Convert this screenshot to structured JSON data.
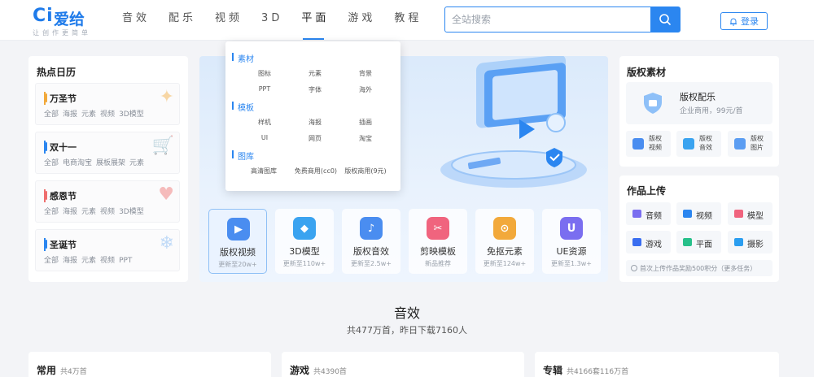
{
  "header": {
    "logo_mark": "Ci",
    "logo_name": "爱给",
    "logo_slogan": "让创作更简单",
    "nav": [
      "音效",
      "配乐",
      "视频",
      "3D",
      "平面",
      "游戏",
      "教程"
    ],
    "active_nav": "平面",
    "search_placeholder": "全站搜索",
    "login_label": "登录"
  },
  "calendar": {
    "title": "热点日历",
    "events": [
      {
        "name": "万圣节",
        "tags": [
          "全部",
          "海报",
          "元素",
          "视频",
          "3D模型"
        ],
        "color": "#f2a93b"
      },
      {
        "name": "双十一",
        "tags": [
          "全部",
          "电商淘宝",
          "展板展架",
          "元素"
        ],
        "color": "#2b86f0"
      },
      {
        "name": "感恩节",
        "tags": [
          "全部",
          "海报",
          "元素",
          "视频",
          "3D模型"
        ],
        "color": "#ef6e6e"
      },
      {
        "name": "圣诞节",
        "tags": [
          "全部",
          "海报",
          "元素",
          "视频",
          "PPT"
        ],
        "color": "#2b86f0"
      }
    ]
  },
  "dropdown": {
    "sections": [
      {
        "title": "素材",
        "items": [
          "图标",
          "元素",
          "背景",
          "PPT",
          "字体",
          "海外"
        ]
      },
      {
        "title": "模板",
        "items": [
          "样机",
          "海报",
          "插画",
          "UI",
          "网页",
          "淘宝"
        ]
      },
      {
        "title": "图库",
        "items": [
          "高清图库",
          "免费商用(cc0)",
          "版权商用(9元)"
        ]
      }
    ]
  },
  "categories": [
    {
      "name": "版权视频",
      "sub": "更新至20w+",
      "color": "#4a8df0",
      "icon_glyph": "▶"
    },
    {
      "name": "3D模型",
      "sub": "更新至110w+",
      "color": "#3aa3f0",
      "icon_glyph": "◆"
    },
    {
      "name": "版权音效",
      "sub": "更新至2.5w+",
      "color": "#4a8df0",
      "icon_glyph": "♪"
    },
    {
      "name": "剪映模板",
      "sub": "新品推荐",
      "color": "#f0647e",
      "icon_glyph": "✂"
    },
    {
      "name": "免抠元素",
      "sub": "更新至124w+",
      "color": "#f2a93b",
      "icon_glyph": "⊙"
    },
    {
      "name": "UE资源",
      "sub": "更新至1.3w+",
      "color": "#7a6ef0",
      "icon_glyph": "U"
    }
  ],
  "copyright": {
    "title": "版权素材",
    "hero_title": "版权配乐",
    "hero_sub": "企业商用，99元/首",
    "tiles": [
      {
        "label": "版权视频",
        "color": "#4a8df0"
      },
      {
        "label": "版权音效",
        "color": "#3aa3f0"
      },
      {
        "label": "版权图片",
        "color": "#5b9df2"
      }
    ]
  },
  "upload": {
    "title": "作品上传",
    "items": [
      {
        "label": "音频",
        "color": "#7a6ef0"
      },
      {
        "label": "视频",
        "color": "#2b86f0"
      },
      {
        "label": "模型",
        "color": "#f0647e"
      },
      {
        "label": "游戏",
        "color": "#3a6ef0"
      },
      {
        "label": "平面",
        "color": "#27c08a"
      },
      {
        "label": "摄影",
        "color": "#2b9ef0"
      }
    ],
    "note": "首次上传作品奖励500积分（更多任务）"
  },
  "section": {
    "title": "音效",
    "subtitle": "共477万首，昨日下载7160人"
  },
  "bottom_cards": [
    {
      "title": "常用",
      "count": "共4万首"
    },
    {
      "title": "游戏",
      "count": "共4390首"
    },
    {
      "title": "专辑",
      "count": "共4166套116万首"
    }
  ]
}
